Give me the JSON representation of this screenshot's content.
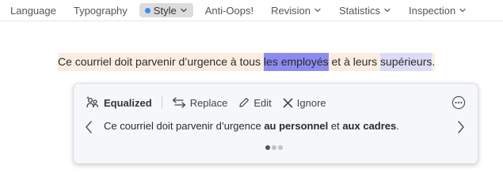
{
  "toolbar": {
    "tabs": [
      {
        "label": "Language"
      },
      {
        "label": "Typography"
      },
      {
        "label": "Style"
      },
      {
        "label": "Anti-Oops!"
      },
      {
        "label": "Revision"
      },
      {
        "label": "Statistics"
      },
      {
        "label": "Inspection"
      }
    ]
  },
  "document": {
    "segments": [
      "Ce courriel doit parvenir d’urgence à tous ",
      "les employés",
      " et à leurs ",
      "supérieurs",
      "."
    ]
  },
  "card": {
    "title": "Equalized",
    "replace_label": "Replace",
    "edit_label": "Edit",
    "ignore_label": "Ignore",
    "suggestion": {
      "before": "Ce courriel doit parvenir d’urgence ",
      "replacement1": "au personnel",
      "middle": " et ",
      "replacement2": "aux cadres",
      "after": "."
    },
    "pager": {
      "current": 1,
      "total": 3
    }
  },
  "colors": {
    "accent_dot": "#3a8ef3",
    "highlight_strong": "#8c8cf0",
    "highlight_light": "#dcdcf7",
    "sentence_bg": "#fbeee1"
  }
}
